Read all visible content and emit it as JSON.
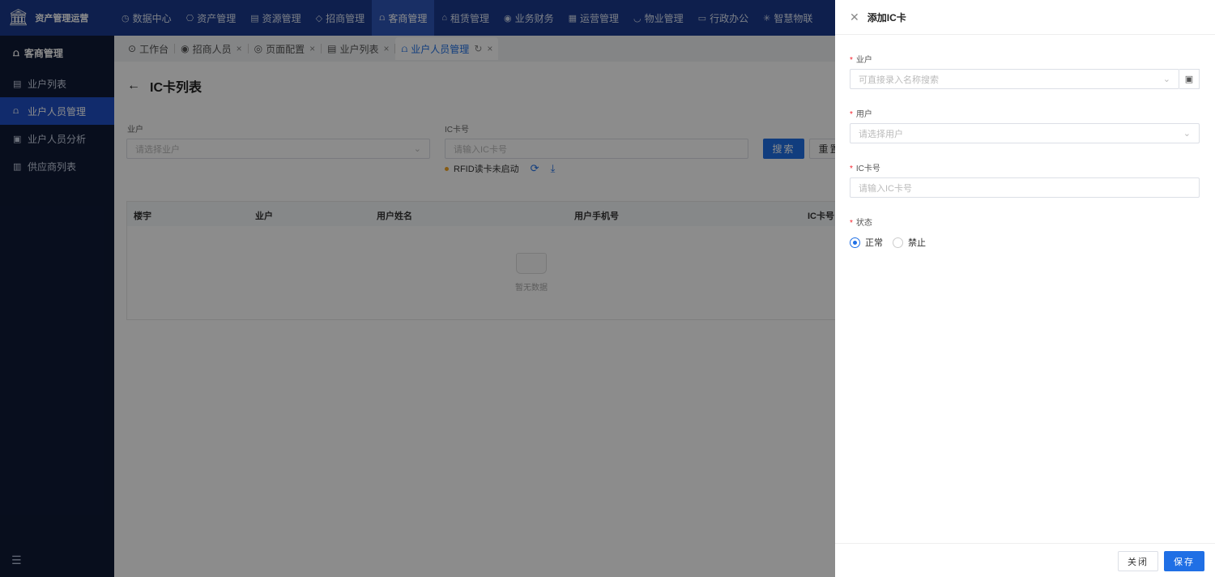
{
  "brand": {
    "logo_icon": "bank-icon",
    "title": "资产管理运营"
  },
  "nav": [
    {
      "icon": "clock-icon",
      "glyph": "◷",
      "label": "数据中心"
    },
    {
      "icon": "cube-icon",
      "glyph": "⎔",
      "label": "资产管理"
    },
    {
      "icon": "building-icon",
      "glyph": "▤",
      "label": "资源管理"
    },
    {
      "icon": "tag-icon",
      "glyph": "◇",
      "label": "招商管理"
    },
    {
      "icon": "users-icon",
      "glyph": "⩍",
      "label": "客商管理"
    },
    {
      "icon": "home-icon",
      "glyph": "⌂",
      "label": "租赁管理"
    },
    {
      "icon": "coin-icon",
      "glyph": "◉",
      "label": "业务财务"
    },
    {
      "icon": "chart-icon",
      "glyph": "▦",
      "label": "运营管理"
    },
    {
      "icon": "bag-icon",
      "glyph": "◡",
      "label": "物业管理"
    },
    {
      "icon": "monitor-icon",
      "glyph": "▭",
      "label": "行政办公"
    },
    {
      "icon": "sun-icon",
      "glyph": "✳",
      "label": "智慧物联"
    }
  ],
  "sidebar": {
    "header": "客商管理",
    "items": [
      {
        "label": "业户列表",
        "glyph": "▤"
      },
      {
        "label": "业户人员管理",
        "glyph": "⩍"
      },
      {
        "label": "业户人员分析",
        "glyph": "▣"
      },
      {
        "label": "供应商列表",
        "glyph": "▥"
      }
    ]
  },
  "tabs": [
    {
      "glyph": "⊙",
      "label": "工作台",
      "closable": false
    },
    {
      "glyph": "◉",
      "label": "招商人员",
      "closable": true
    },
    {
      "glyph": "◎",
      "label": "页面配置",
      "closable": true
    },
    {
      "glyph": "▤",
      "label": "业户列表",
      "closable": true
    },
    {
      "glyph": "⩍",
      "label": "业户人员管理",
      "closable": true
    }
  ],
  "page": {
    "title": "IC卡列表",
    "filters": {
      "owner_label": "业户",
      "owner_placeholder": "请选择业户",
      "card_label": "IC卡号",
      "card_placeholder": "请输入IC卡号"
    },
    "search_label": "搜索",
    "reset_label": "重置",
    "rfid_status": "RFID读卡未启动",
    "table": {
      "columns": [
        "楼宇",
        "业户",
        "用户姓名",
        "用户手机号",
        "IC卡号"
      ],
      "empty_text": "暂无数据"
    }
  },
  "drawer": {
    "title": "添加IC卡",
    "fields": {
      "owner_label": "业户",
      "owner_placeholder": "可直接录入名称搜索",
      "user_label": "用户",
      "user_placeholder": "请选择用户",
      "card_label": "IC卡号",
      "card_placeholder": "请输入IC卡号",
      "status_label": "状态",
      "status_normal": "正常",
      "status_disabled": "禁止"
    },
    "close_label": "关闭",
    "save_label": "保存"
  },
  "colors": {
    "nav_bg": "#1a3a8c",
    "sidebar_bg": "#0f1a36",
    "primary": "#1f6fe5"
  }
}
